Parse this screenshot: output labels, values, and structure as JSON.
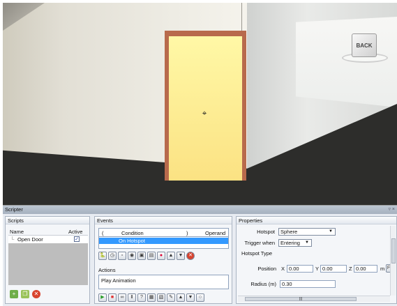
{
  "viewport": {
    "back_label": "BACK",
    "target_glyph": "⌖"
  },
  "scripter": {
    "title": "Scripter",
    "window_buttons": "▿ ×"
  },
  "scripts_panel": {
    "title": "Scripts",
    "col_name": "Name",
    "col_active": "Active",
    "rows": [
      {
        "name": "Open Door",
        "active_mark": "✓"
      }
    ],
    "buttons": [
      "add-script-icon",
      "duplicate-script-icon",
      "delete-script-icon"
    ]
  },
  "events_panel": {
    "title": "Events",
    "header": {
      "open_paren": "(",
      "condition": "Condition",
      "close_paren": ")",
      "operand": "Operand"
    },
    "selected_event": "On Hotspot",
    "actions_title": "Actions",
    "action_item": "Play Animation",
    "event_toolbar_icons": [
      "python-icon",
      "clock-icon",
      "key-icon",
      "camera-icon",
      "car-icon",
      "variable-icon",
      "record-icon",
      "move-up-icon",
      "move-down-icon",
      "delete-icon"
    ],
    "action_toolbar_icons": [
      "play-icon",
      "stop-icon",
      "link-icon",
      "pause-icon",
      "help-icon",
      "property-icon",
      "media-icon",
      "edit-icon",
      "move-up-icon",
      "move-down-icon",
      "circle-icon"
    ]
  },
  "properties_panel": {
    "title": "Properties",
    "hotspot_label": "Hotspot",
    "hotspot_value": "Sphere",
    "trigger_label": "Trigger when",
    "trigger_value": "Entering",
    "type_label": "Hotspot Type",
    "position_label": "Position",
    "x_label": "X",
    "x_value": "0.00",
    "y_label": "Y",
    "y_value": "0.00",
    "z_label": "Z",
    "z_value": "0.00",
    "unit": "m",
    "extra_button": "F",
    "radius_label": "Radius (m)",
    "radius_value": "0.30"
  },
  "colors": {
    "selection": "#3399ff",
    "door_frame": "#b86a4c",
    "door_panel": "#fbe283"
  }
}
